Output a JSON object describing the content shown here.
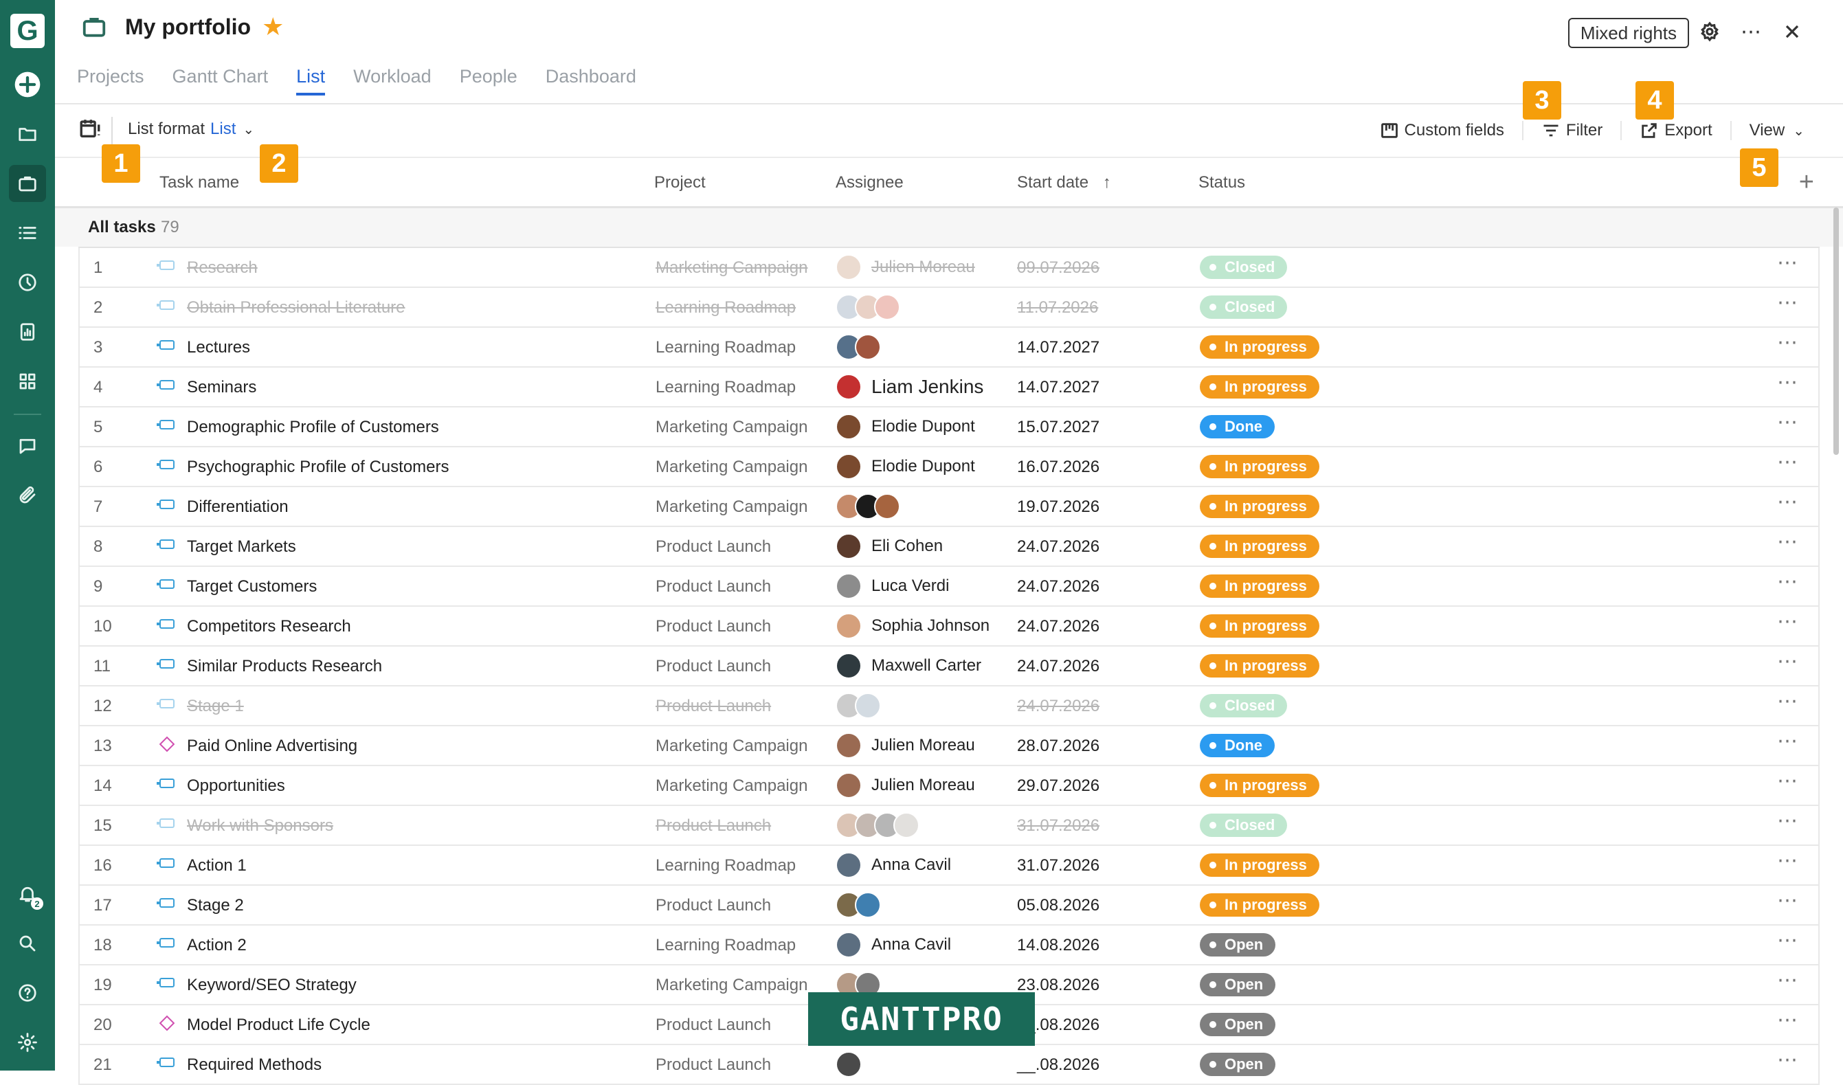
{
  "app": {
    "logo_letter": "G",
    "brand_color": "#1a6a58",
    "sidebar_icons": [
      "plus-circle-icon",
      "folder-icon",
      "briefcase-icon",
      "list-icon",
      "clock-icon",
      "report-icon",
      "grid-icon",
      "chat-icon",
      "paperclip-icon"
    ],
    "sidebar_bottom_icons": [
      "bell-icon",
      "search-icon",
      "help-icon",
      "gear-icon"
    ],
    "notification_count": "2"
  },
  "header": {
    "title": "My portfolio",
    "favorite": true,
    "mixed_rights": "Mixed rights",
    "tabs": [
      {
        "label": "Projects",
        "active": false
      },
      {
        "label": "Gantt Chart",
        "active": false
      },
      {
        "label": "List",
        "active": true
      },
      {
        "label": "Workload",
        "active": false
      },
      {
        "label": "People",
        "active": false
      },
      {
        "label": "Dashboard",
        "active": false
      }
    ]
  },
  "toolbar": {
    "list_format_label": "List format",
    "list_format_value": "List",
    "custom_fields": "Custom fields",
    "filter": "Filter",
    "export": "Export",
    "view": "View"
  },
  "callouts": [
    "1",
    "2",
    "3",
    "4",
    "5"
  ],
  "columns": {
    "task_name": "Task name",
    "project": "Project",
    "assignee": "Assignee",
    "start_date": "Start date",
    "status": "Status"
  },
  "group": {
    "label": "All tasks",
    "count": "79"
  },
  "rows": [
    {
      "num": "1",
      "name": "Research",
      "type": "task",
      "project": "Marketing Campaign",
      "assignees": [
        "#d9b8a3"
      ],
      "assignee_name": "Julien Moreau",
      "date": "09.07.2026",
      "status": "Closed",
      "closed": true
    },
    {
      "num": "2",
      "name": "Obtain Professional Literature",
      "type": "task",
      "project": "Learning Roadmap",
      "assignees": [
        "#a9b6c6",
        "#d5a58f",
        "#e08a7d"
      ],
      "assignee_name": "",
      "date": "11.07.2026",
      "status": "Closed",
      "closed": true
    },
    {
      "num": "3",
      "name": "Lectures",
      "type": "task",
      "project": "Learning Roadmap",
      "assignees": [
        "#56708a",
        "#a0553e"
      ],
      "assignee_name": "",
      "date": "14.07.2027",
      "status": "In progress",
      "closed": false
    },
    {
      "num": "4",
      "name": "Seminars",
      "type": "task",
      "project": "Learning Roadmap",
      "assignees": [
        "#c43030"
      ],
      "assignee_name": "Liam Jenkins",
      "date": "14.07.2027",
      "status": "In progress",
      "closed": false,
      "big": true
    },
    {
      "num": "5",
      "name": "Demographic Profile of Customers",
      "type": "task",
      "project": "Marketing Campaign",
      "assignees": [
        "#7a4a2e"
      ],
      "assignee_name": "Elodie Dupont",
      "date": "15.07.2027",
      "status": "Done",
      "closed": false
    },
    {
      "num": "6",
      "name": "Psychographic Profile of Customers",
      "type": "task",
      "project": "Marketing Campaign",
      "assignees": [
        "#7a4a2e"
      ],
      "assignee_name": "Elodie Dupont",
      "date": "16.07.2026",
      "status": "In progress",
      "closed": false
    },
    {
      "num": "7",
      "name": "Differentiation",
      "type": "task",
      "project": "Marketing Campaign",
      "assignees": [
        "#c58a6a",
        "#1b1b1b",
        "#a6643f"
      ],
      "assignee_name": "",
      "date": "19.07.2026",
      "status": "In progress",
      "closed": false
    },
    {
      "num": "8",
      "name": "Target Markets",
      "type": "task",
      "project": "Product Launch",
      "assignees": [
        "#5b3b2c"
      ],
      "assignee_name": "Eli Cohen",
      "date": "24.07.2026",
      "status": "In progress",
      "closed": false
    },
    {
      "num": "9",
      "name": "Target Customers",
      "type": "task",
      "project": "Product Launch",
      "assignees": [
        "#8c8c8c"
      ],
      "assignee_name": "Luca Verdi",
      "date": "24.07.2026",
      "status": "In progress",
      "closed": false
    },
    {
      "num": "10",
      "name": "Competitors Research",
      "type": "task",
      "project": "Product Launch",
      "assignees": [
        "#d5a07c"
      ],
      "assignee_name": "Sophia Johnson",
      "date": "24.07.2026",
      "status": "In progress",
      "closed": false
    },
    {
      "num": "11",
      "name": "Similar Products Research",
      "type": "task",
      "project": "Product Launch",
      "assignees": [
        "#2f3a3f"
      ],
      "assignee_name": "Maxwell Carter",
      "date": "24.07.2026",
      "status": "In progress",
      "closed": false
    },
    {
      "num": "12",
      "name": "Stage 1",
      "type": "task",
      "project": "Product Launch",
      "assignees": [
        "#9a9a9a",
        "#a8b8c6"
      ],
      "assignee_name": "",
      "date": "24.07.2026",
      "status": "Closed",
      "closed": true
    },
    {
      "num": "13",
      "name": "Paid Online Advertising",
      "type": "milestone",
      "project": "Marketing Campaign",
      "assignees": [
        "#9a6a52"
      ],
      "assignee_name": "Julien Moreau",
      "date": "28.07.2026",
      "status": "Done",
      "closed": false
    },
    {
      "num": "14",
      "name": "Opportunities",
      "type": "task",
      "project": "Marketing Campaign",
      "assignees": [
        "#9a6a52"
      ],
      "assignee_name": "Julien Moreau",
      "date": "29.07.2026",
      "status": "In progress",
      "closed": false
    },
    {
      "num": "15",
      "name": "Work with Sponsors",
      "type": "task",
      "project": "Product Launch",
      "assignees": [
        "#b98a6e",
        "#8a7466",
        "#6f6f6f",
        "#c7c2bd"
      ],
      "assignee_name": "",
      "date": "31.07.2026",
      "status": "Closed",
      "closed": true
    },
    {
      "num": "16",
      "name": "Action 1",
      "type": "task",
      "project": "Learning Roadmap",
      "assignees": [
        "#5c6e80"
      ],
      "assignee_name": "Anna Cavil",
      "date": "31.07.2026",
      "status": "In progress",
      "closed": false
    },
    {
      "num": "17",
      "name": "Stage 2",
      "type": "task",
      "project": "Product Launch",
      "assignees": [
        "#7b6a4a",
        "#3f7fb0"
      ],
      "assignee_name": "",
      "date": "05.08.2026",
      "status": "In progress",
      "closed": false
    },
    {
      "num": "18",
      "name": "Action 2",
      "type": "task",
      "project": "Learning Roadmap",
      "assignees": [
        "#5c6e80"
      ],
      "assignee_name": "Anna Cavil",
      "date": "14.08.2026",
      "status": "Open",
      "closed": false
    },
    {
      "num": "19",
      "name": "Keyword/SEO Strategy",
      "type": "task",
      "project": "Marketing Campaign",
      "assignees": [
        "#b59a86",
        "#7a7a7a"
      ],
      "assignee_name": "",
      "date": "23.08.2026",
      "status": "Open",
      "closed": false
    },
    {
      "num": "20",
      "name": "Model Product Life Cycle",
      "type": "milestone",
      "project": "Product Launch",
      "assignees": [
        "#3a2a22",
        "#8a4a2a",
        "#5a3a2a"
      ],
      "assignee_name": "",
      "date": "__.08.2026",
      "status": "Open",
      "closed": false
    },
    {
      "num": "21",
      "name": "Required Methods",
      "type": "task",
      "project": "Product Launch",
      "assignees": [
        "#4a4a4a"
      ],
      "assignee_name": "",
      "date": "__.08.2026",
      "status": "Open",
      "closed": false
    }
  ],
  "watermark": "GANTTPRO",
  "status_colors": {
    "Closed": "#bfe7cf",
    "In progress": "#f39a1b",
    "Done": "#2b9bf0",
    "Open": "#7f7f7f"
  }
}
